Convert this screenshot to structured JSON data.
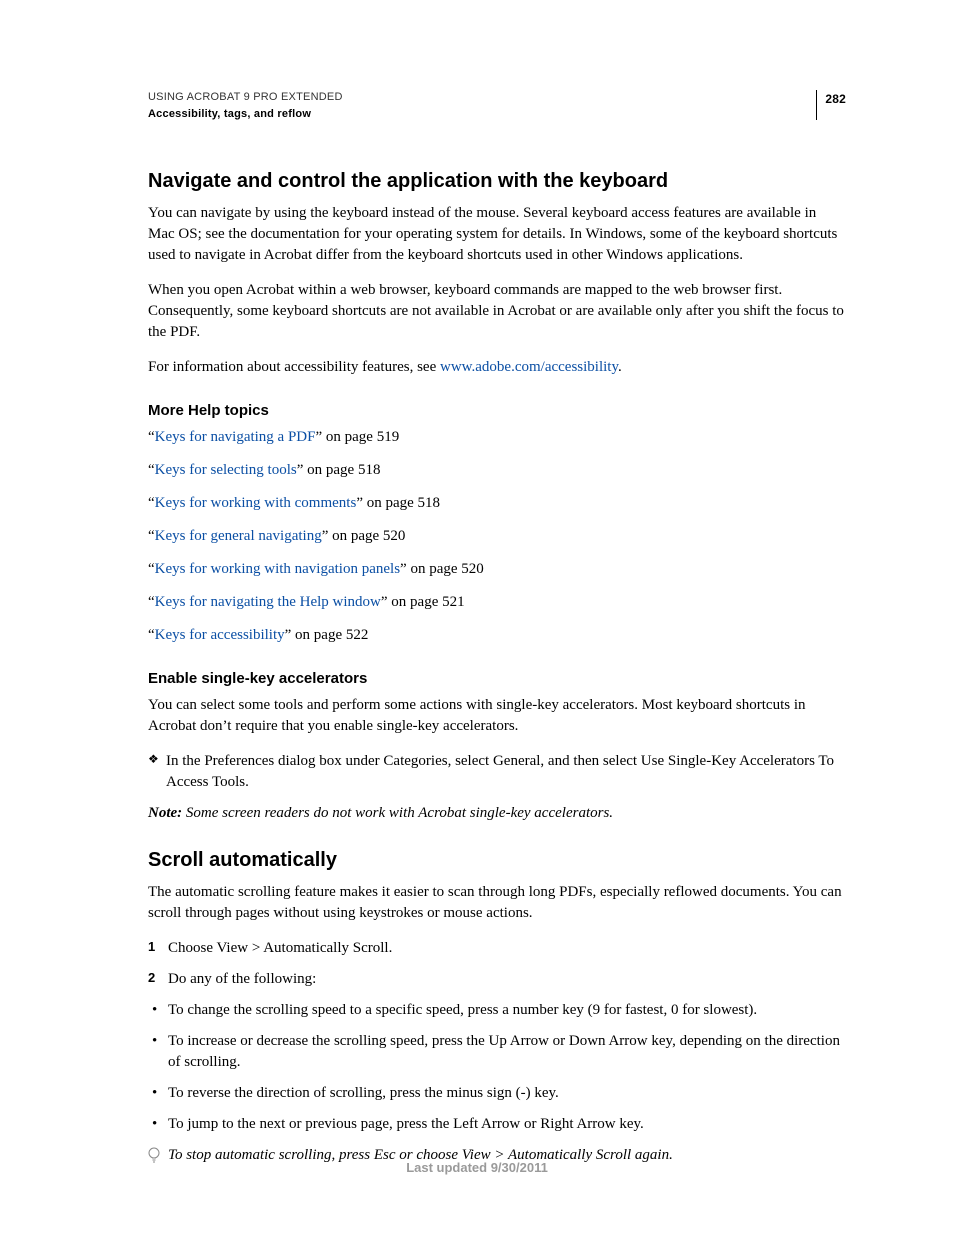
{
  "header": {
    "product": "USING ACROBAT 9 PRO EXTENDED",
    "section": "Accessibility, tags, and reflow",
    "page_number": "282"
  },
  "s1": {
    "title": "Navigate and control the application with the keyboard",
    "p1": "You can navigate by using the keyboard instead of the mouse. Several keyboard access features are available in Mac OS; see the documentation for your operating system for details. In Windows, some of the keyboard shortcuts used to navigate in Acrobat differ from the keyboard shortcuts used in other Windows applications.",
    "p2": "When you open Acrobat within a web browser, keyboard commands are mapped to the web browser first. Consequently, some keyboard shortcuts are not available in Acrobat or are available only after you shift the focus to the PDF.",
    "p3a": "For information about accessibility features, see ",
    "p3_link": "www.adobe.com/accessibility",
    "p3b": "."
  },
  "help": {
    "title": "More Help topics",
    "items": [
      {
        "link": "Keys for navigating a PDF",
        "suffix": "” on page 519"
      },
      {
        "link": "Keys for selecting tools",
        "suffix": "” on page 518"
      },
      {
        "link": "Keys for working with comments",
        "suffix": "” on page 518"
      },
      {
        "link": "Keys for general navigating",
        "suffix": "” on page 520"
      },
      {
        "link": "Keys for working with navigation panels",
        "suffix": "” on page 520"
      },
      {
        "link": "Keys for navigating the Help window",
        "suffix": "” on page 521"
      },
      {
        "link": "Keys for accessibility",
        "suffix": "” on page 522"
      }
    ],
    "open_quote": "“"
  },
  "s2": {
    "title": "Enable single-key accelerators",
    "p1": "You can select some tools and perform some actions with single-key accelerators. Most keyboard shortcuts in Acrobat don’t require that you enable single-key accelerators.",
    "bullet": "In the Preferences dialog box under Categories, select General, and then select Use Single-Key Accelerators To Access Tools.",
    "note_label": "Note:",
    "note_body": " Some screen readers do not work with Acrobat single-key accelerators."
  },
  "s3": {
    "title": "Scroll automatically",
    "p1": "The automatic scrolling feature makes it easier to scan through long PDFs, especially reflowed documents. You can scroll through pages without using keystrokes or mouse actions.",
    "step1": "Choose View > Automatically Scroll.",
    "step2": "Do any of the following:",
    "b1": "To change the scrolling speed to a specific speed, press a number key (9 for fastest, 0 for slowest).",
    "b2": "To increase or decrease the scrolling speed, press the Up Arrow or Down Arrow key, depending on the direction of scrolling.",
    "b3": "To reverse the direction of scrolling, press the minus sign (-) key.",
    "b4": "To jump to the next or previous page, press the Left Arrow or Right Arrow key.",
    "tip": "To stop automatic scrolling, press Esc or choose View > Automatically Scroll again."
  },
  "footer": {
    "text": "Last updated 9/30/2011"
  }
}
